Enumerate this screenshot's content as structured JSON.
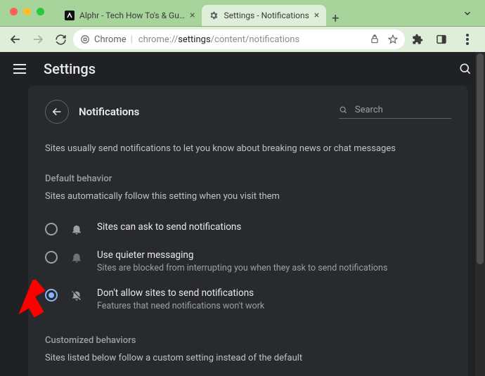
{
  "window": {
    "tabs": [
      {
        "title": "Alphr - Tech How To's & Guide",
        "active": false
      },
      {
        "title": "Settings - Notifications",
        "active": true
      }
    ]
  },
  "omnibox": {
    "scheme_label": "Chrome",
    "url_pre": "chrome://",
    "url_strong": "settings",
    "url_post": "/content/notifications"
  },
  "app": {
    "title": "Settings"
  },
  "panel": {
    "title": "Notifications",
    "search_placeholder": "Search",
    "description": "Sites usually send notifications to let you know about breaking news or chat messages",
    "default_behavior": {
      "label": "Default behavior",
      "sub": "Sites automatically follow this setting when you visit them",
      "options": [
        {
          "title": "Sites can ask to send notifications",
          "sub": "",
          "selected": false
        },
        {
          "title": "Use quieter messaging",
          "sub": "Sites are blocked from interrupting you when they ask to send notifications",
          "selected": false
        },
        {
          "title": "Don't allow sites to send notifications",
          "sub": "Features that need notifications won't work",
          "selected": true
        }
      ]
    },
    "customized": {
      "label": "Customized behaviors",
      "sub": "Sites listed below follow a custom setting instead of the default"
    }
  }
}
